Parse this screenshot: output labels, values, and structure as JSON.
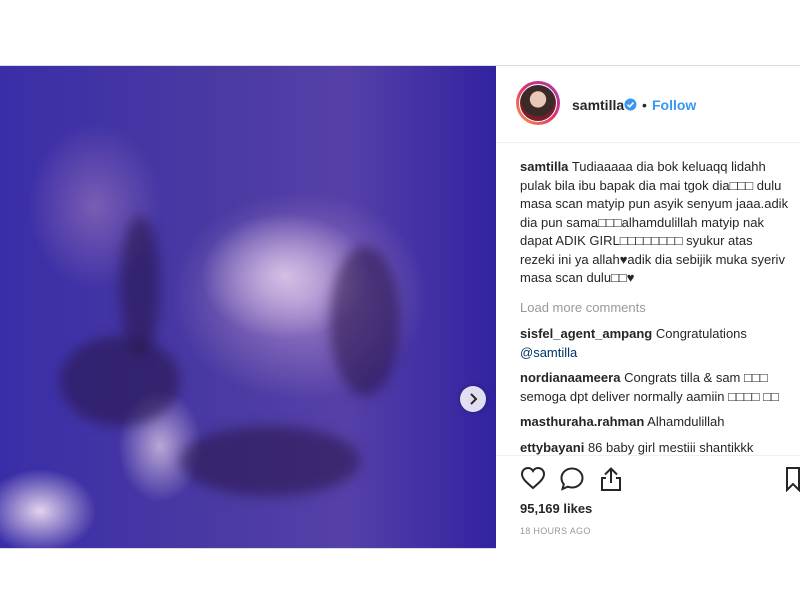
{
  "post": {
    "username": "samtilla",
    "follow_label": "Follow",
    "dot": "•",
    "caption": "Tudiaaaaa dia bok keluaqq lidahh pulak bila ibu bapak dia mai tgok dia□□□ dulu masa scan matyip pun asyik senyum jaaa.adik dia pun sama□□□alhamdulillah matyip nak dapat ADIK GIRL□□□□□□□□ syukur atas rezeki ini ya allah♥adik dia sebijik muka syeriv masa scan dulu□□♥",
    "load_more": "Load more comments",
    "comments": [
      {
        "user": "sisfel_agent_ampang",
        "text": "Congratulations ",
        "mention": "@samtilla"
      },
      {
        "user": "nordianaameera",
        "text": "Congrats tilla & sam □□□ semoga dpt deliver normally aamiin □□□□ □□",
        "mention": ""
      },
      {
        "user": "masthuraha.rahman",
        "text": "Alhamdulillah",
        "mention": ""
      },
      {
        "user": "ettybayani",
        "text": "86 baby girl mestiii shantikkk",
        "mention": ""
      }
    ],
    "likes": "95,169 likes",
    "time": "18 HOURS AGO"
  },
  "icons": {
    "verified": "verified-badge-icon",
    "like": "heart-icon",
    "comment": "comment-bubble-icon",
    "share": "share-icon",
    "save": "bookmark-icon",
    "next": "chevron-right-icon"
  },
  "colors": {
    "link": "#3897f0",
    "muted": "#999999",
    "text": "#262626"
  }
}
